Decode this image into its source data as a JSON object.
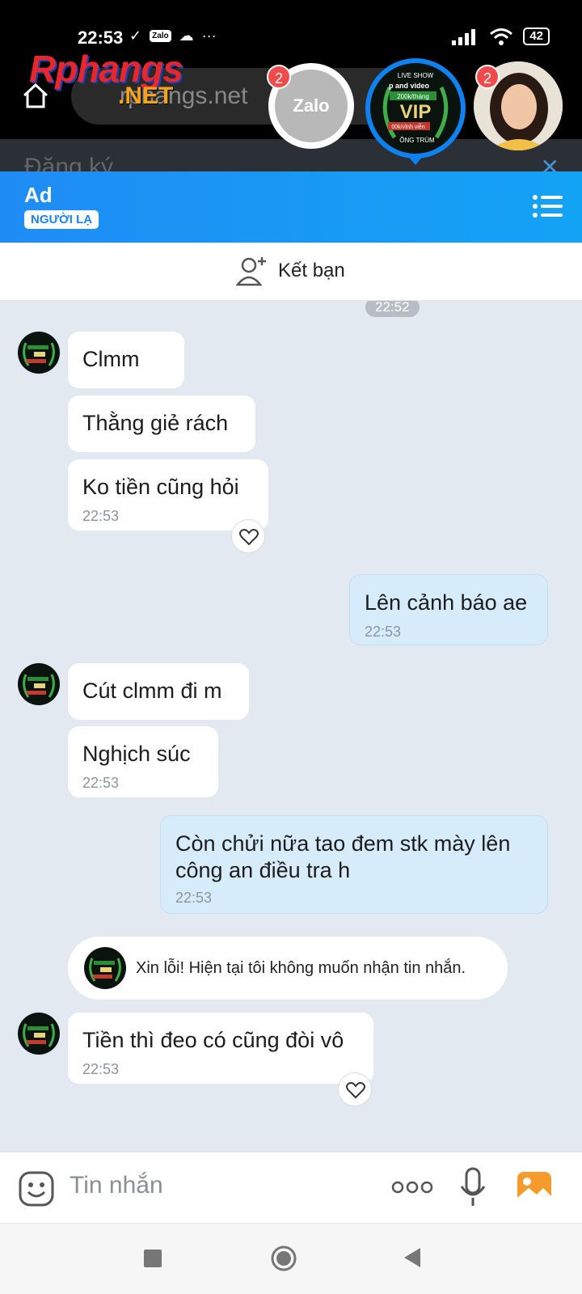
{
  "status_bar": {
    "time": "22:53",
    "zalo_mini": "Zalo",
    "battery": "42"
  },
  "browser": {
    "url": "rphangs.net",
    "behind_text": "Đăng ký",
    "logo_main": "Rphangs",
    "logo_sub": ".NET"
  },
  "chat_heads": [
    {
      "name": "Zalo",
      "badge": "2"
    },
    {
      "name": "VIP"
    },
    {
      "name": "girl",
      "badge": "2"
    }
  ],
  "vip_avatar": {
    "line1": "LIVE SHOW",
    "line2": "p and video",
    "line3": "200k/tháng",
    "line4": "VIP",
    "line5": "00k/vĩnh viễn",
    "line6": "ÔNG TRÙM"
  },
  "chat_header": {
    "name": "Ad",
    "tag": "NGƯỜI LẠ"
  },
  "add_friend": {
    "label": "Kết bạn"
  },
  "messages": {
    "time_chip": "22:52",
    "m1": {
      "text": "Clmm"
    },
    "m2": {
      "text": "Thằng giẻ rách"
    },
    "m3": {
      "text": "Ko tiền cũng hỏi",
      "time": "22:53"
    },
    "m4": {
      "text": "Lên cảnh báo ae",
      "time": "22:53"
    },
    "m5": {
      "text": "Cút clmm đi m"
    },
    "m6": {
      "text": "Nghịch súc",
      "time": "22:53"
    },
    "m7": {
      "text_line1": "Còn chửi nữa tao đem stk mày lên",
      "text_line2": "công an điều tra h",
      "time": "22:53"
    },
    "system": {
      "text": "Xin lỗi! Hiện tại tôi không muốn nhận tin nhắn."
    },
    "m8": {
      "text": "Tiền thì đeo có cũng đòi vô",
      "time": "22:53"
    }
  },
  "input": {
    "placeholder": "Tin nhắn"
  },
  "colors": {
    "header_start": "#1f8cf5",
    "header_end": "#13a3f5",
    "chat_bg": "#e2e9f1",
    "mine_bubble": "#d7ecfb"
  }
}
